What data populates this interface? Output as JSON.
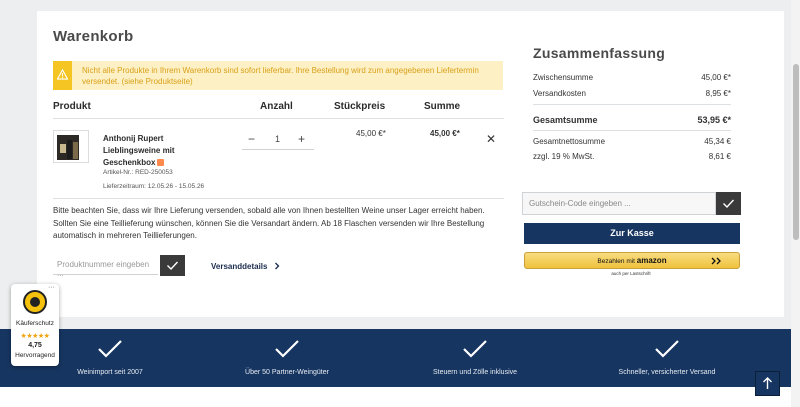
{
  "cart": {
    "title": "Warenkorb",
    "warning": "Nicht alle Produkte in Ihrem Warenkorb sind sofort lieferbar. Ihre Bestellung wird zum angegebenen Liefertermin versendet. (siehe Produktseite)",
    "columns": {
      "product": "Produkt",
      "quantity": "Anzahl",
      "unit_price": "Stückpreis",
      "total": "Summe"
    },
    "item": {
      "name": "Anthonij Rupert Lieblingsweine mit Geschenkbox",
      "article_no": "Artikel-Nr.: RED-250053",
      "delivery": "Lieferzeitraum: 12.05.26 - 15.05.26",
      "quantity": "1",
      "minus": "−",
      "plus": "+",
      "unit_price": "45,00 €*",
      "total": "45,00 €*",
      "remove": "✕"
    },
    "note": "Bitte beachten Sie, dass wir Ihre Lieferung versenden, sobald alle von Ihnen bestellten Weine unser Lager erreicht haben. Sollten Sie eine Teillieferung wünschen, können Sie die Versandart ändern. Ab 18 Flaschen versenden wir Ihre Bestellung automatisch in mehreren Teillieferungen.",
    "product_input_placeholder": "Produktnummer eingeben ...",
    "shipping_link": "Versanddetails"
  },
  "summary": {
    "title": "Zusammenfassung",
    "subtotal_label": "Zwischensumme",
    "subtotal_value": "45,00 €*",
    "shipping_label": "Versandkosten",
    "shipping_value": "8,95 €*",
    "total_label": "Gesamtsumme",
    "total_value": "53,95 €*",
    "net_label": "Gesamtnettosumme",
    "net_value": "45,34 €",
    "vat_label": "zzgl. 19 % MwSt.",
    "vat_value": "8,61 €",
    "coupon_placeholder": "Gutschein-Code eingeben ...",
    "checkout_button": "Zur Kasse",
    "amazon_label": "Bezahlen mit",
    "amazon_brand": "amazon",
    "amazon_note": "auch per Lastschrift"
  },
  "trust_badge": {
    "label": "Käuferschutz",
    "stars": "★★★★★",
    "rating": "4,75",
    "rating_text": "Hervorragend",
    "menu": "···"
  },
  "features": [
    {
      "icon": "check-icon",
      "label": "Weinimport seit 2007"
    },
    {
      "icon": "check-icon",
      "label": "Über 50 Partner-Weingüter"
    },
    {
      "icon": "check-icon",
      "label": "Steuern und Zölle inklusive"
    },
    {
      "icon": "check-icon",
      "label": "Schneller, versicherter Versand"
    }
  ],
  "colors": {
    "primary": "#163560",
    "warning_bg": "#fdf0c4",
    "warning_bar": "#f5c524",
    "footer_text": "#e7ebf2"
  }
}
